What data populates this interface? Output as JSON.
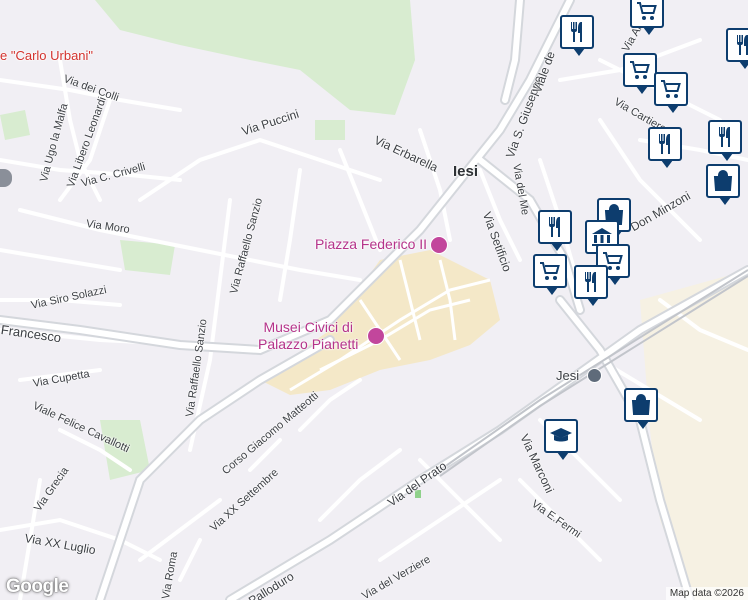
{
  "map": {
    "street_labels": {
      "carlo_urbani": "e \"Carlo Urbani\"",
      "via_dei_colli": "Via dei Colli",
      "via_ugo_la_malfa": "Via Ugo la Malfa",
      "via_libero_leonardi": "Via Libero Leonardi",
      "via_puccini": "Via Puccini",
      "via_erbarella": "Via Erbarella",
      "via_s_giuseppe": "Via S. Giuseppe",
      "viale_de": "Viale de",
      "via_c_crivelli": "Via C. Crivelli",
      "via_moro": "Via Moro",
      "via_raffaello_sanzio_top": "Via Raffaello Sanzio",
      "via_raffaello_sanzio_bottom": "Via Raffaello Sanzio",
      "via_siro_solazzi": "Via Siro Solazzi",
      "francesco": "Francesco",
      "via_cupetta": "Via Cupetta",
      "viale_felice_cavallotti": "Viale Felice Cavallotti",
      "via_grecia": "Via Grecia",
      "via_xx_luglio": "Via XX Luglio",
      "corso_giacomo_matteotti": "Corso Giacomo Matteotti",
      "via_xx_settembre": "Via XX Settembre",
      "via_del_prato": "Via del Prato",
      "via_setificio": "Via Setificio",
      "via_del_me": "Via del Me",
      "don_minzoni": "Don Minzoni",
      "via_marconi": "Via Marconi",
      "via_e_fermi": "Via E.Fermi",
      "via_del_verziere": "Via del Verziere",
      "via_roma": "Via Roma",
      "palloduro": "Palloduro",
      "via_an": "Via An",
      "via_cartiere": "Via Cartiere"
    },
    "town_labels": {
      "iesi": "Iesi",
      "jesi_station": "Jesi"
    },
    "pois": {
      "piazza_federico": "Piazza Federico II",
      "musei_civici": "Musei Civici di\nPalazzo Pianetti"
    },
    "footer": {
      "google": "Google",
      "attribution": "Map data ©2026"
    },
    "colors": {
      "background": "#f1eff4",
      "road": "#ffffff",
      "major_road": "#c9ccd2",
      "park": "#cfe8c5",
      "center": "#f3e6c6",
      "marker_border": "#0d3d6e",
      "poi": "#b5338a"
    },
    "markers": [
      "restaurant-marker",
      "shopping-cart-marker",
      "shopping-cart-marker",
      "shopping-cart-marker",
      "restaurant-marker",
      "restaurant-marker",
      "shopping-bag-marker",
      "shopping-bag-marker",
      "restaurant-marker",
      "museum-marker",
      "shopping-cart-marker",
      "shopping-cart-marker",
      "restaurant-marker",
      "shopping-bag-marker",
      "school-marker",
      "restaurant-marker"
    ]
  }
}
